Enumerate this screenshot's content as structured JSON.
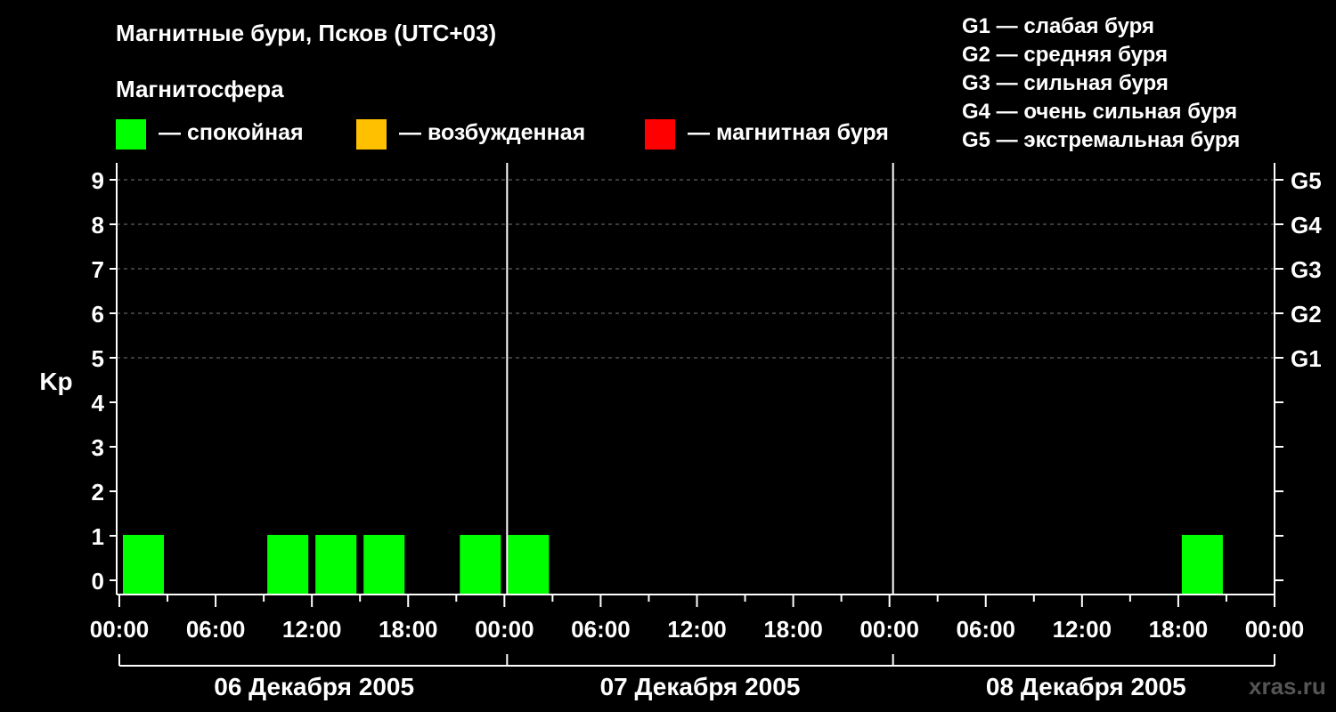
{
  "header": {
    "title": "Магнитные бури, Псков (UTC+03)",
    "subtitle": "Магнитосфера"
  },
  "legend": [
    {
      "label": "— спокойная",
      "color": "#00ff00"
    },
    {
      "label": "— возбужденная",
      "color": "#ffc000"
    },
    {
      "label": "— магнитная буря",
      "color": "#ff0000"
    }
  ],
  "storm_levels": [
    "G1 — слабая буря",
    "G2 — средняя буря",
    "G3 — сильная буря",
    "G4 — очень сильная буря",
    "G5 — экстремальная буря"
  ],
  "watermark": "xras.ru",
  "chart_data": {
    "type": "bar",
    "ylabel": "Kp",
    "ylim": [
      0,
      9
    ],
    "y_ticks": [
      "0",
      "1",
      "2",
      "3",
      "4",
      "5",
      "6",
      "7",
      "8",
      "9"
    ],
    "right_axis_labels": [
      {
        "kp": 5,
        "label": "G1"
      },
      {
        "kp": 6,
        "label": "G2"
      },
      {
        "kp": 7,
        "label": "G3"
      },
      {
        "kp": 8,
        "label": "G4"
      },
      {
        "kp": 9,
        "label": "G5"
      }
    ],
    "x_tick_labels": [
      "00:00",
      "06:00",
      "12:00",
      "18:00",
      "00:00",
      "06:00",
      "12:00",
      "18:00",
      "00:00",
      "06:00",
      "12:00",
      "18:00",
      "00:00"
    ],
    "days": [
      "06 Декабря 2005",
      "07 Декабря 2005",
      "08 Декабря 2005"
    ],
    "interval_hours": 3,
    "bar_color": "#00ff00",
    "grid": "dashed horizontal at Kp 5–9",
    "series": [
      {
        "values": [
          1,
          0,
          0,
          1,
          1,
          1,
          0,
          1,
          1,
          0,
          0,
          0,
          0,
          0,
          0,
          0,
          0,
          0,
          0,
          0,
          0,
          0,
          1,
          0
        ]
      }
    ]
  }
}
